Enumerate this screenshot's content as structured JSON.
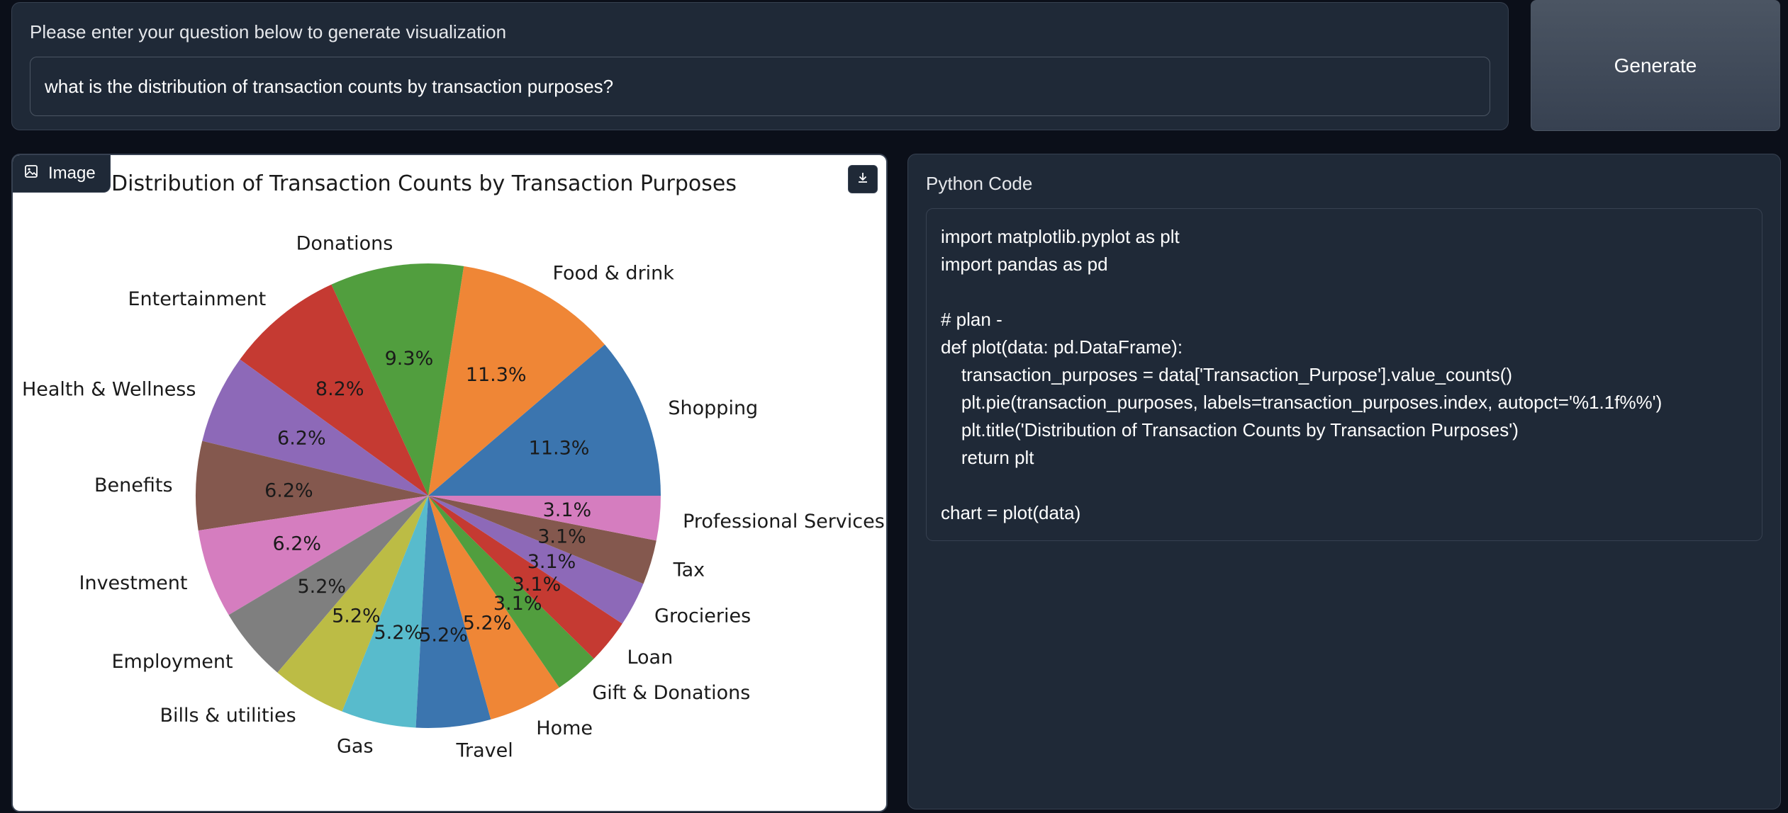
{
  "question": {
    "label": "Please enter your question below to generate visualization",
    "value": "what is the distribution of transaction counts by transaction purposes?"
  },
  "generate_button": {
    "label": "Generate"
  },
  "image_panel": {
    "tag_label": "Image",
    "tag_icon": "image-icon",
    "download_icon": "download-icon"
  },
  "code_panel": {
    "label": "Python Code",
    "lines": [
      "import matplotlib.pyplot as plt",
      "import pandas as pd",
      "",
      "# plan -",
      "def plot(data: pd.DataFrame):",
      "    transaction_purposes = data['Transaction_Purpose'].value_counts()",
      "    plt.pie(transaction_purposes, labels=transaction_purposes.index, autopct='%1.1f%%')",
      "    plt.title('Distribution of Transaction Counts by Transaction Purposes')",
      "    return plt",
      "",
      "chart = plot(data)"
    ]
  },
  "chart_data": {
    "type": "pie",
    "title": "Distribution of Transaction Counts by Transaction Purposes",
    "start_angle_deg": 0,
    "direction": "counterclockwise",
    "slices": [
      {
        "label": "Shopping",
        "value": 11.3,
        "pct": "11.3%",
        "color": "#3b75af"
      },
      {
        "label": "Food & drink",
        "value": 11.3,
        "pct": "11.3%",
        "color": "#ef8636"
      },
      {
        "label": "Donations",
        "value": 9.3,
        "pct": "9.3%",
        "color": "#519e3e"
      },
      {
        "label": "Entertainment",
        "value": 8.2,
        "pct": "8.2%",
        "color": "#c53a32"
      },
      {
        "label": "Health & Wellness",
        "value": 6.2,
        "pct": "6.2%",
        "color": "#8d69b8"
      },
      {
        "label": "Benefits",
        "value": 6.2,
        "pct": "6.2%",
        "color": "#84584e"
      },
      {
        "label": "Investment",
        "value": 6.2,
        "pct": "6.2%",
        "color": "#d57dbf"
      },
      {
        "label": "Employment",
        "value": 5.2,
        "pct": "5.2%",
        "color": "#7f7f7f"
      },
      {
        "label": "Bills & utilities",
        "value": 5.2,
        "pct": "5.2%",
        "color": "#bcbc45"
      },
      {
        "label": "Gas",
        "value": 5.2,
        "pct": "5.2%",
        "color": "#58bbcc"
      },
      {
        "label": "Travel",
        "value": 5.2,
        "pct": "5.2%",
        "color": "#3b75af"
      },
      {
        "label": "Home",
        "value": 5.2,
        "pct": "5.2%",
        "color": "#ef8636"
      },
      {
        "label": "Gift & Donations",
        "value": 3.1,
        "pct": "3.1%",
        "color": "#519e3e"
      },
      {
        "label": "Loan",
        "value": 3.1,
        "pct": "3.1%",
        "color": "#c53a32"
      },
      {
        "label": "Grocieries",
        "value": 3.1,
        "pct": "3.1%",
        "color": "#8d69b8"
      },
      {
        "label": "Tax",
        "value": 3.1,
        "pct": "3.1%",
        "color": "#84584e"
      },
      {
        "label": "Professional Services",
        "value": 3.1,
        "pct": "3.1%",
        "color": "#d57dbf"
      }
    ]
  }
}
